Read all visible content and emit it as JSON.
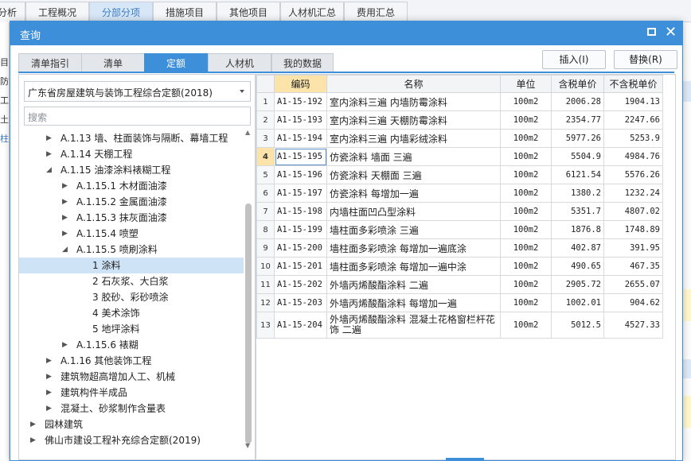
{
  "background": {
    "tabs": [
      {
        "label": "分析",
        "active": false
      },
      {
        "label": "工程概况",
        "active": false
      },
      {
        "label": "分部分项",
        "active": true
      },
      {
        "label": "措施项目",
        "active": false
      },
      {
        "label": "其他项目",
        "active": false
      },
      {
        "label": "人材机汇总",
        "active": false
      },
      {
        "label": "费用汇总",
        "active": false
      }
    ],
    "left_chars": [
      "目",
      "防",
      "工",
      "土",
      "柱"
    ]
  },
  "dialog": {
    "title": "查询",
    "tabs": [
      {
        "label": "清单指引",
        "active": false
      },
      {
        "label": "清单",
        "active": false
      },
      {
        "label": "定额",
        "active": true
      },
      {
        "label": "人材机",
        "active": false
      },
      {
        "label": "我的数据",
        "active": false
      }
    ],
    "insert_label": "插入(I)",
    "replace_label": "替换(R)",
    "quota_library": "广东省房屋建筑与装饰工程综合定额(2018)",
    "search_placeholder": "搜索",
    "tree": [
      {
        "label": "A.1.13 墙、柱面装饰与隔断、幕墙工程",
        "level": 1,
        "arrow": "▶"
      },
      {
        "label": "A.1.14 天棚工程",
        "level": 1,
        "arrow": "▶"
      },
      {
        "label": "A.1.15 油漆涂料裱糊工程",
        "level": 1,
        "arrow": "◢"
      },
      {
        "label": "A.1.15.1 木材面油漆",
        "level": 2,
        "arrow": "▶"
      },
      {
        "label": "A.1.15.2 金属面油漆",
        "level": 2,
        "arrow": "▶"
      },
      {
        "label": "A.1.15.3 抹灰面油漆",
        "level": 2,
        "arrow": "▶"
      },
      {
        "label": "A.1.15.4 喷塑",
        "level": 2,
        "arrow": "▶"
      },
      {
        "label": "A.1.15.5 喷刷涂料",
        "level": 2,
        "arrow": "◢"
      },
      {
        "label": "1 涂料",
        "level": 3,
        "arrow": "",
        "selected": true
      },
      {
        "label": "2 石灰浆、大白浆",
        "level": 3,
        "arrow": ""
      },
      {
        "label": "3 胶砂、彩砂喷涂",
        "level": 3,
        "arrow": ""
      },
      {
        "label": "4 美术涂饰",
        "level": 3,
        "arrow": ""
      },
      {
        "label": "5 地坪涂料",
        "level": 3,
        "arrow": ""
      },
      {
        "label": "A.1.15.6 裱糊",
        "level": 2,
        "arrow": "▶"
      },
      {
        "label": "A.1.16 其他装饰工程",
        "level": 1,
        "arrow": "▶"
      },
      {
        "label": "建筑物超高增加人工、机械",
        "level": 1,
        "arrow": "▶"
      },
      {
        "label": "建筑构件半成品",
        "level": 1,
        "arrow": "▶"
      },
      {
        "label": "混凝土、砂浆制作含量表",
        "level": 1,
        "arrow": "▶"
      },
      {
        "label": "园林建筑",
        "level": 0,
        "arrow": "▶"
      },
      {
        "label": "佛山市建设工程补充综合定额(2019)",
        "level": 0,
        "arrow": "▶"
      }
    ],
    "table": {
      "headers": [
        "编码",
        "名称",
        "单位",
        "含税单价",
        "不含税单价"
      ],
      "rows": [
        {
          "no": "1",
          "code": "A1-15-192",
          "name": "室内涂料三遍 内墙防霉涂料",
          "unit": "100m2",
          "tax_price": "2006.28",
          "notax_price": "1904.13"
        },
        {
          "no": "2",
          "code": "A1-15-193",
          "name": "室内涂料三遍 天棚防霉涂料",
          "unit": "100m2",
          "tax_price": "2354.77",
          "notax_price": "2247.66"
        },
        {
          "no": "3",
          "code": "A1-15-194",
          "name": "室内涂料三遍 内墙彩绒涂料",
          "unit": "100m2",
          "tax_price": "5977.26",
          "notax_price": "5253.9"
        },
        {
          "no": "4",
          "code": "A1-15-195",
          "name": "仿瓷涂料 墙面 三遍",
          "unit": "100m2",
          "tax_price": "5504.9",
          "notax_price": "4984.76",
          "current": true
        },
        {
          "no": "5",
          "code": "A1-15-196",
          "name": "仿瓷涂料 天棚面 三遍",
          "unit": "100m2",
          "tax_price": "6121.54",
          "notax_price": "5576.26"
        },
        {
          "no": "6",
          "code": "A1-15-197",
          "name": "仿瓷涂料 每增加一遍",
          "unit": "100m2",
          "tax_price": "1380.2",
          "notax_price": "1232.24"
        },
        {
          "no": "7",
          "code": "A1-15-198",
          "name": "内墙柱面凹凸型涂料",
          "unit": "100m2",
          "tax_price": "5351.7",
          "notax_price": "4807.02"
        },
        {
          "no": "8",
          "code": "A1-15-199",
          "name": "墙柱面多彩喷涂 三遍",
          "unit": "100m2",
          "tax_price": "1876.8",
          "notax_price": "1748.89"
        },
        {
          "no": "9",
          "code": "A1-15-200",
          "name": "墙柱面多彩喷涂 每增加一遍底涂",
          "unit": "100m2",
          "tax_price": "402.87",
          "notax_price": "391.95"
        },
        {
          "no": "10",
          "code": "A1-15-201",
          "name": "墙柱面多彩喷涂 每增加一遍中涂",
          "unit": "100m2",
          "tax_price": "490.65",
          "notax_price": "467.35"
        },
        {
          "no": "11",
          "code": "A1-15-202",
          "name": "外墙丙烯酸酯涂料 二遍",
          "unit": "100m2",
          "tax_price": "2905.72",
          "notax_price": "2655.07"
        },
        {
          "no": "12",
          "code": "A1-15-203",
          "name": "外墙丙烯酸酯涂料 每增加一遍",
          "unit": "100m2",
          "tax_price": "1002.01",
          "notax_price": "904.62"
        },
        {
          "no": "13",
          "code": "A1-15-204",
          "name": "外墙丙烯酸酯涂料 混凝土花格窗栏杆花饰 二遍",
          "unit": "100m2",
          "tax_price": "5012.5",
          "notax_price": "4527.33"
        }
      ]
    }
  },
  "colors": {
    "accent": "#3d8fd9",
    "header_highlight": "#fbe3a9",
    "selection": "#cfe3f6"
  }
}
